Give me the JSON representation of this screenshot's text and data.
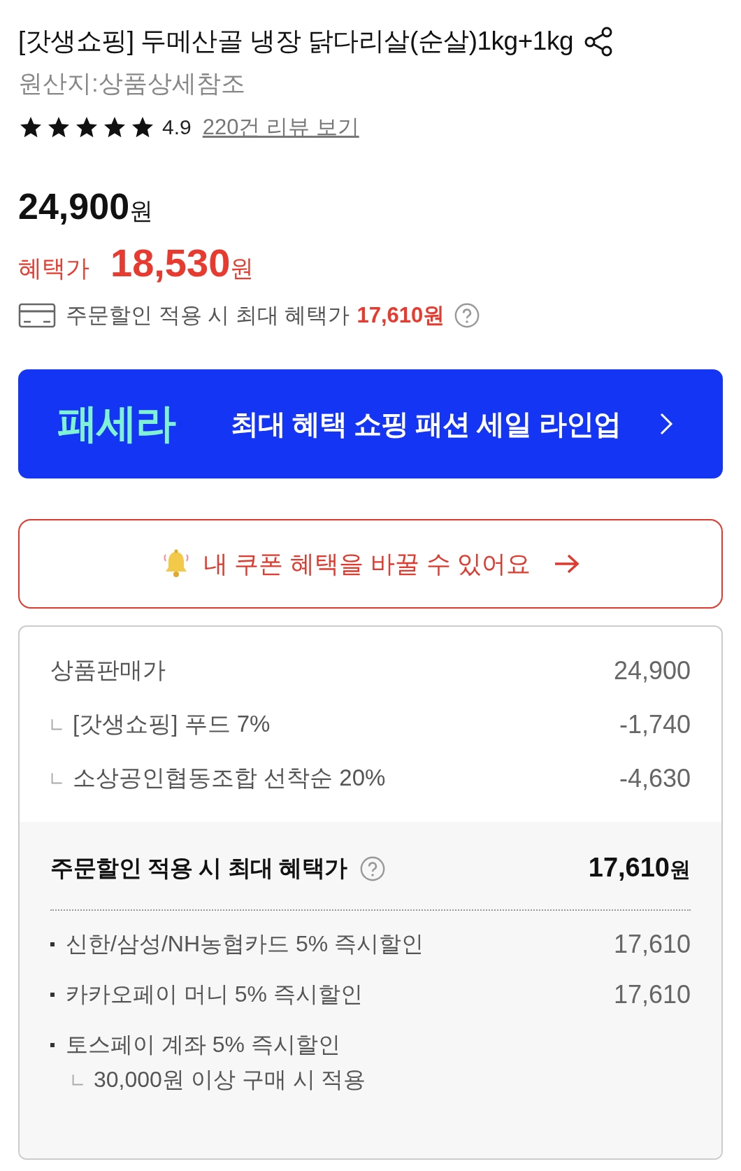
{
  "product": {
    "title": "[갓생쇼핑] 두메산골 냉장 닭다리살(순살)1kg+1kg",
    "origin": "원산지:상품상세참조",
    "stars": 5,
    "rating": "4.9",
    "review_link": "220건 리뷰 보기"
  },
  "price": {
    "original": "24,900",
    "original_unit": "원",
    "benefit_label": "혜택가",
    "benefit": "18,530",
    "benefit_unit": "원"
  },
  "max_benefit": {
    "label": "주문할인 적용 시 최대 혜택가",
    "price": "17,610원"
  },
  "banner": {
    "logo": "패세라",
    "text": "최대 혜택 쇼핑 패션 세일 라인업"
  },
  "coupon": {
    "text": "내 쿠폰 혜택을 바꿀 수 있어요"
  },
  "breakdown": {
    "rows": [
      {
        "kind": "main",
        "label": "상품판매가",
        "value": "24,900"
      },
      {
        "kind": "sub",
        "label": "[갓생쇼핑] 푸드 7%",
        "value": "-1,740"
      },
      {
        "kind": "sub",
        "label": "소상공인협동조합 선착순 20%",
        "value": "-4,630"
      }
    ],
    "total": {
      "label": "주문할인 적용 시 최대 혜택가",
      "value": "17,610",
      "unit": "원"
    },
    "offers": [
      {
        "label": "신한/삼성/NH농협카드 5% 즉시할인",
        "value": "17,610"
      },
      {
        "label": "카카오페이 머니 5% 즉시할인",
        "value": "17,610"
      },
      {
        "label": "토스페이 계좌 5% 즉시할인",
        "note": "30,000원 이상 구매 시 적용"
      }
    ]
  }
}
